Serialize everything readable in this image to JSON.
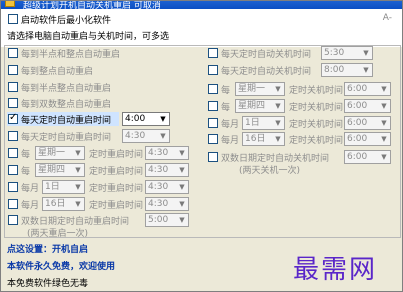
{
  "window": {
    "title": "超级计划开机自动关机重启 可取消"
  },
  "top": {
    "minimize_on_start": "启动软件后最小化软件",
    "instruction": "请选择电脑自动重启与关机时间，可多选",
    "minimize_icon": "A-"
  },
  "left_panel": [
    {
      "label": "每到半点和整点自动重启",
      "checked": false
    },
    {
      "label": "每到整点自动重启",
      "checked": false
    },
    {
      "label": "每到半点整点自动重启",
      "checked": false
    },
    {
      "label": "每到双数整点自动重启",
      "checked": false
    },
    {
      "label": "每天定时自动重启时间",
      "checked": true,
      "time": "4:00"
    },
    {
      "label": "每天定时自动重启时间",
      "checked": false,
      "time": "4:30"
    },
    {
      "prefix": "每",
      "combo": "星期一",
      "label": "定时重启时间",
      "time": "4:30"
    },
    {
      "prefix": "每",
      "combo": "星期四",
      "label": "定时重启时间",
      "time": "4:30"
    },
    {
      "prefix": "每月",
      "combo": "1日",
      "label": "定时重启时间",
      "time": "4:30"
    },
    {
      "prefix": "每月",
      "combo": "16日",
      "label": "定时重启时间",
      "time": "4:30"
    },
    {
      "label": "双数日期定时自动重启时间",
      "checked": false,
      "time": "5:00"
    }
  ],
  "left_note": "(两天重启一次)",
  "right_panel": [
    {
      "label": "每天定时自动关机时间",
      "time": "5:30"
    },
    {
      "label": "每天定时自动关机时间",
      "time": "8:00"
    },
    {
      "prefix": "每",
      "combo": "星期一",
      "label": "定时关机时间",
      "time": "6:00"
    },
    {
      "prefix": "每",
      "combo": "星期四",
      "label": "定时关机时间",
      "time": "6:00"
    },
    {
      "prefix": "每月",
      "combo": "1日",
      "label": "定时关机时间",
      "time": "6:00"
    },
    {
      "prefix": "每月",
      "combo": "16日",
      "label": "定时关机时间",
      "time": "6:00"
    },
    {
      "label": "双数日期定时自动关机时间",
      "time": "6:00"
    }
  ],
  "right_note": "(两天关机一次)",
  "bottom": {
    "tip": "点这设置：开机自启",
    "free_note": "本软件永久免费，欢迎使用",
    "safe_note": "本免费软件绿色无毒",
    "brand": "最需网"
  }
}
